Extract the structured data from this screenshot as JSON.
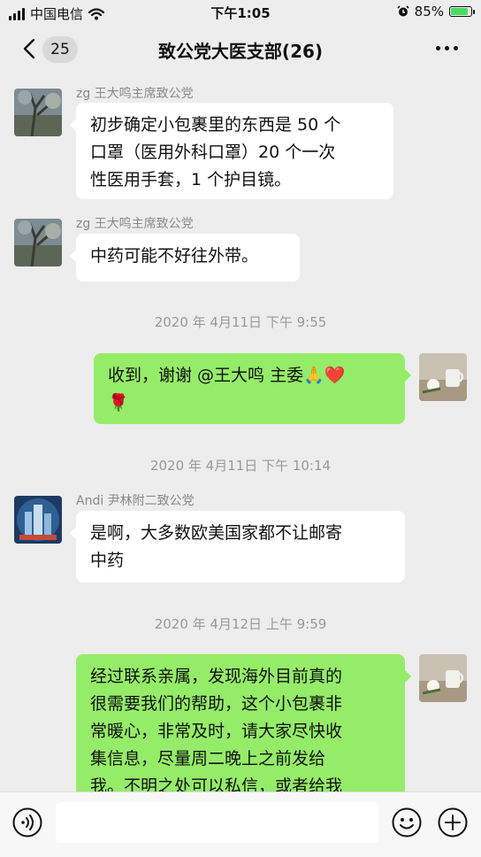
{
  "status_bar": {
    "carrier": "中国电信",
    "time": "下午1:05",
    "battery_level": "85%",
    "battery_fraction": 0.85
  },
  "nav": {
    "unread_count": "25",
    "title": "致公党大医支部(26)"
  },
  "messages": [
    {
      "type": "incoming",
      "sender": "zg 王大鸣主席致公党",
      "avatar": "tree-photo-avatar",
      "lines": [
        "初步确定小包裹里的东西是 50 个",
        "口罩（医用外科口罩）20 个一次",
        "性医用手套，1 个护目镜。"
      ]
    },
    {
      "type": "incoming",
      "sender": "zg 王大鸣主席致公党",
      "avatar": "tree-photo-avatar",
      "lines": [
        "中药可能不好往外带。"
      ]
    },
    {
      "type": "timestamp",
      "text": "2020 年 4月11日 下午 9:55"
    },
    {
      "type": "outgoing",
      "avatar": "cup-flower-photo-avatar",
      "lines": [
        "收到，谢谢 @王大鸣 主委🙏❤️",
        "🌹"
      ]
    },
    {
      "type": "timestamp",
      "text": "2020 年 4月11日 下午 10:14"
    },
    {
      "type": "incoming",
      "sender": "Andi 尹林附二致公党",
      "avatar": "city-photo-avatar",
      "lines": [
        "是啊，大多数欧美国家都不让邮寄",
        "中药"
      ]
    },
    {
      "type": "timestamp",
      "text": "2020 年 4月12日 上午 9:59"
    },
    {
      "type": "outgoing",
      "avatar": "cup-flower-photo-avatar",
      "lines": [
        "经过联系亲属，发现海外目前真的",
        "很需要我们的帮助，这个小包裹非",
        "常暖心，非常及时，请大家尽快收",
        "集信息，尽量周二晚上之前发给",
        "我。不明之处可以私信，或者给我"
      ]
    }
  ],
  "input_bar": {
    "placeholder": "",
    "voice_icon": "voice-icon",
    "emoji_icon": "emoji-icon",
    "plus_icon": "plus-icon"
  }
}
